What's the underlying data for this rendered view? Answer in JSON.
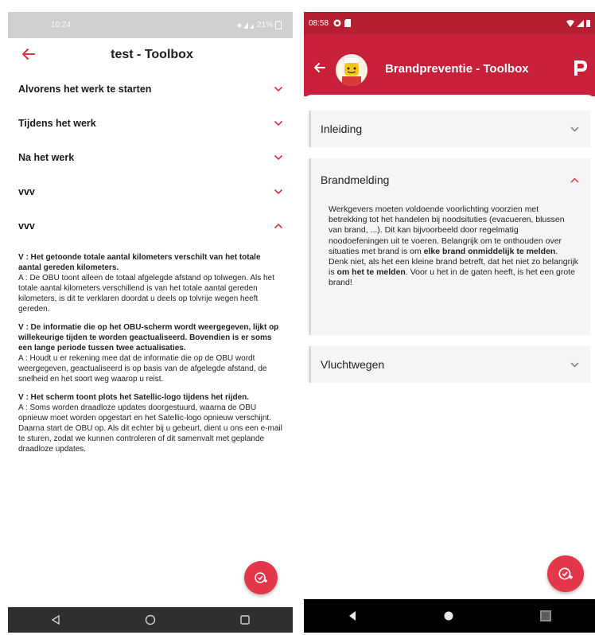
{
  "left": {
    "status": {
      "time": "10:24",
      "battery": "21%"
    },
    "title": "test - Toolbox",
    "sections": [
      {
        "label": "Alvorens het werk te starten",
        "expanded": false
      },
      {
        "label": "Tijdens het werk",
        "expanded": false
      },
      {
        "label": "Na het werk",
        "expanded": false
      },
      {
        "label": "vvv",
        "expanded": false
      },
      {
        "label": "vvv",
        "expanded": true
      }
    ],
    "faq": [
      {
        "q": "V : Het getoonde totale aantal kilometers verschilt van het totale aantal gereden kilometers.",
        "a": "A : De OBU toont alleen de totaal afgelegde afstand op tolwegen. Als het totale aantal kilometers verschillend is van het totale aantal gereden kilometers, is dit te verklaren doordat u deels op tolvrije wegen heeft gereden."
      },
      {
        "q": "V : De informatie die op het OBU-scherm wordt weergegeven, lijkt op willekeurige tijden te worden geactualiseerd. Bovendien is er soms een lange periode tussen twee actualisaties.",
        "a": "A : Houdt u er rekening mee dat de informatie die op de OBU wordt weergegeven, geactualiseerd is op basis van de afgelegde afstand, de snelheid en het soort weg waarop u reist."
      },
      {
        "q": "V : Het scherm toont plots het Satellic-logo tijdens het rijden.",
        "a": "A : Soms worden draadloze updates doorgestuurd, waarna de OBU opnieuw moet worden opgestart en het Satellic-logo opnieuw verschijnt. Daarna start de OBU op. Als dit echter bij u gebeurt, dient u ons een e-mail te sturen, zodat we kunnen controleren of dit samenvalt met geplande draadloze updates."
      }
    ]
  },
  "right": {
    "status": {
      "time": "08:58"
    },
    "title": "Brandpreventie - Toolbox",
    "sections": [
      {
        "label": "Inleiding",
        "expanded": false
      },
      {
        "label": "Brandmelding",
        "expanded": true
      },
      {
        "label": "Vluchtwegen",
        "expanded": false
      }
    ],
    "brandmelding_text": {
      "p1": "Werkgevers moeten voldoende voorlichting voorzien met betrekking tot het handelen bij noodsituties (evacueren, blussen van brand, ...). Dit kan bijvoorbeeld door regelmatig noodoefeningen uit te voeren. Belangrijk om te onthouden over situaties met brand is om ",
      "bold1": "elke brand onmiddelijk te melden",
      "p2": ". Denk niet, als het een kleine brand betreft, dat het niet zo belangrijk is ",
      "bold2": "om het te melden",
      "p3": ". Voor u het in de gaten heeft, is het een grote brand!"
    }
  },
  "colors": {
    "brand_red": "#c8203a",
    "fab_red": "#e5374a",
    "status_red": "#b61f2f"
  }
}
